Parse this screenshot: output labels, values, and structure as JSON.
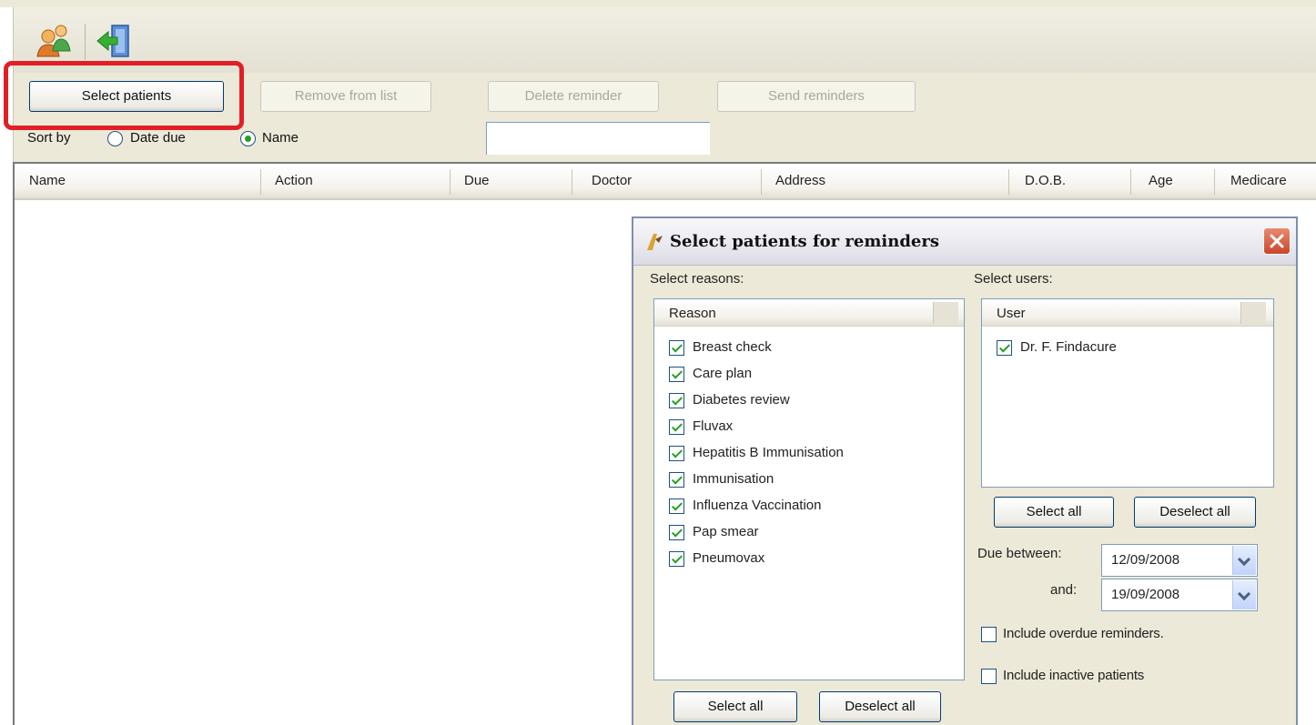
{
  "toolbar": {
    "icons": [
      "patients-icon",
      "exit-icon"
    ]
  },
  "actions": {
    "select_patients": "Select patients",
    "remove_from_list": "Remove from list",
    "delete_reminder": "Delete reminder",
    "send_reminders": "Send reminders"
  },
  "sort": {
    "label": "Sort by",
    "options": [
      {
        "label": "Date due",
        "checked": false
      },
      {
        "label": "Name",
        "checked": true
      }
    ]
  },
  "grid": {
    "columns": [
      "Name",
      "Action",
      "Due",
      "Doctor",
      "Address",
      "D.O.B.",
      "Age",
      "Medicare"
    ]
  },
  "dialog": {
    "title": "Select patients for reminders",
    "reasons_label": "Select reasons:",
    "users_label": "Select users:",
    "reasons_header": "Reason",
    "reasons": [
      {
        "label": "Breast check",
        "checked": true
      },
      {
        "label": "Care plan",
        "checked": true
      },
      {
        "label": "Diabetes review",
        "checked": true
      },
      {
        "label": "Fluvax",
        "checked": true
      },
      {
        "label": "Hepatitis B Immunisation",
        "checked": true
      },
      {
        "label": "Immunisation",
        "checked": true
      },
      {
        "label": "Influenza Vaccination",
        "checked": true
      },
      {
        "label": "Pap smear",
        "checked": true
      },
      {
        "label": "Pneumovax",
        "checked": true
      }
    ],
    "users_header": "User",
    "users": [
      {
        "label": "Dr. F. Findacure",
        "checked": true
      }
    ],
    "select_all": "Select all",
    "deselect_all": "Deselect all",
    "due_between_label": "Due between:",
    "and_label": "and:",
    "due_from": "12/09/2008",
    "due_to": "19/09/2008",
    "include_overdue": "Include overdue reminders.",
    "include_inactive": "Include inactive patients"
  },
  "colors": {
    "highlight": "#e21f26",
    "check": "#21a121",
    "window_bg": "#ece9d8"
  }
}
